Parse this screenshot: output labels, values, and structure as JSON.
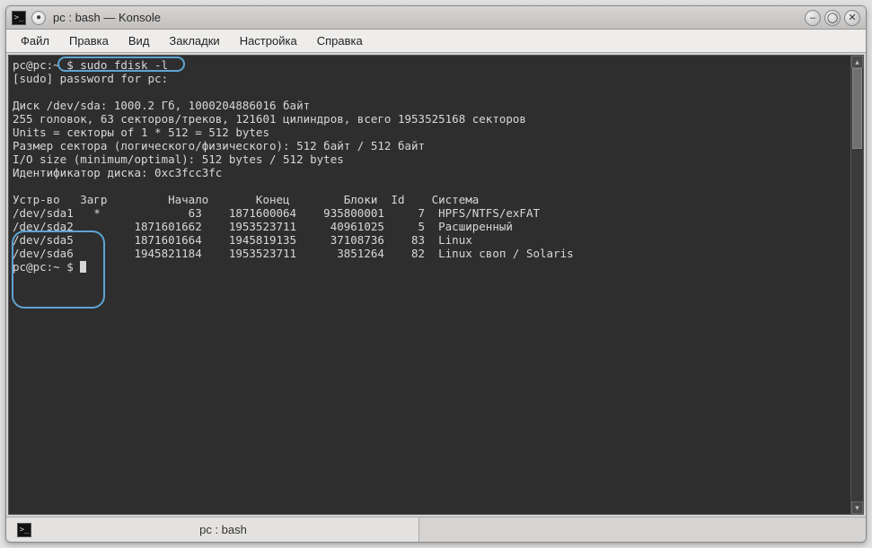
{
  "window": {
    "title": "pc : bash — Konsole",
    "pin_glyph": "●"
  },
  "window_controls": {
    "min": "–",
    "max": "◯",
    "close": "✕"
  },
  "menu": {
    "file": "Файл",
    "edit": "Правка",
    "view": "Вид",
    "bookmarks": "Закладки",
    "settings": "Настройка",
    "help": "Справка"
  },
  "terminal": {
    "prompt1_user": "pc@pc:~",
    "prompt1_symbol": "$",
    "command1": "sudo fdisk -l",
    "sudo_line": "[sudo] password for pc:",
    "disk_line": "Диск /dev/sda: 1000.2 Гб, 1000204886016 байт",
    "heads_line": "255 головок, 63 секторов/треков, 121601 цилиндров, всего 1953525168 секторов",
    "units_line": "Units = секторы of 1 * 512 = 512 bytes",
    "sector_size_line": "Размер сектора (логического/физического): 512 байт / 512 байт",
    "io_size_line": "I/O size (minimum/optimal): 512 bytes / 512 bytes",
    "disk_id_line": "Идентификатор диска: 0xc3fcc3fc",
    "header": {
      "device": "Устр-во",
      "boot": "Загр",
      "start": "Начало",
      "end": "Конец",
      "blocks": "Блоки",
      "id": "Id",
      "system": "Система"
    },
    "partitions": [
      {
        "dev": "/dev/sda1",
        "boot": "*",
        "start": "63",
        "end": "1871600064",
        "blocks": "935800001",
        "id": "7",
        "system": "HPFS/NTFS/exFAT"
      },
      {
        "dev": "/dev/sda2",
        "boot": " ",
        "start": "1871601662",
        "end": "1953523711",
        "blocks": "40961025",
        "id": "5",
        "system": "Расширенный"
      },
      {
        "dev": "/dev/sda5",
        "boot": " ",
        "start": "1871601664",
        "end": "1945819135",
        "blocks": "37108736",
        "id": "83",
        "system": "Linux"
      },
      {
        "dev": "/dev/sda6",
        "boot": " ",
        "start": "1945821184",
        "end": "1953523711",
        "blocks": "3851264",
        "id": "82",
        "system": "Linux своп / Solaris"
      }
    ],
    "prompt2_user": "pc@pc:~",
    "prompt2_symbol": "$"
  },
  "tab": {
    "label": "pc : bash"
  },
  "scrollbar": {
    "up": "▴",
    "down": "▾"
  }
}
